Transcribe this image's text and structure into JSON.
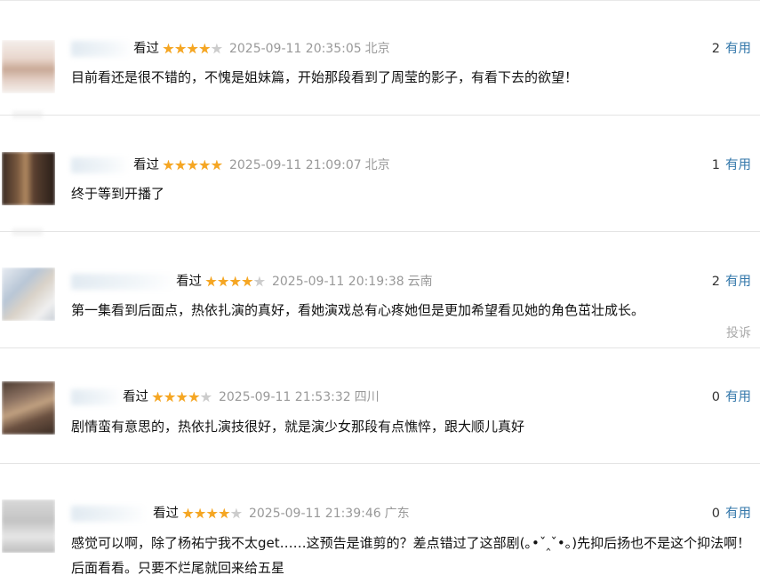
{
  "comments": [
    {
      "watched": "看过",
      "rating": 4,
      "time": "2025-09-11 20:35:05",
      "location": "北京",
      "useful_count": "2",
      "useful_label": "有用",
      "text": "目前看还是很不错的，不愧是姐妹篇，开始那段看到了周莹的影子，有看下去的欲望！"
    },
    {
      "watched": "看过",
      "rating": 5,
      "time": "2025-09-11 21:09:07",
      "location": "北京",
      "useful_count": "1",
      "useful_label": "有用",
      "text": "终于等到开播了"
    },
    {
      "watched": "看过",
      "rating": 4,
      "time": "2025-09-11 20:19:38",
      "location": "云南",
      "useful_count": "2",
      "useful_label": "有用",
      "text": "第一集看到后面点，热依扎演的真好，看她演戏总有心疼她但是更加希望看见她的角色茁壮成长。",
      "report_label": "投诉"
    },
    {
      "watched": "看过",
      "rating": 4,
      "time": "2025-09-11 21:53:32",
      "location": "四川",
      "useful_count": "0",
      "useful_label": "有用",
      "text": "剧情蛮有意思的，热依扎演技很好，就是演少女那段有点憔悴，跟大顺儿真好"
    },
    {
      "watched": "看过",
      "rating": 4,
      "time": "2025-09-11 21:39:46",
      "location": "广东",
      "useful_count": "0",
      "useful_label": "有用",
      "text": "感觉可以啊，除了杨祐宁我不太get……这预告是谁剪的？差点错过了这部剧(｡•ˇ‸ˇ•｡)先抑后扬也不是这个抑法啊！后面看看。只要不烂尾就回来给五星"
    }
  ],
  "colors": {
    "link": "#3377aa",
    "star": "#f5a623",
    "muted": "#999999"
  }
}
